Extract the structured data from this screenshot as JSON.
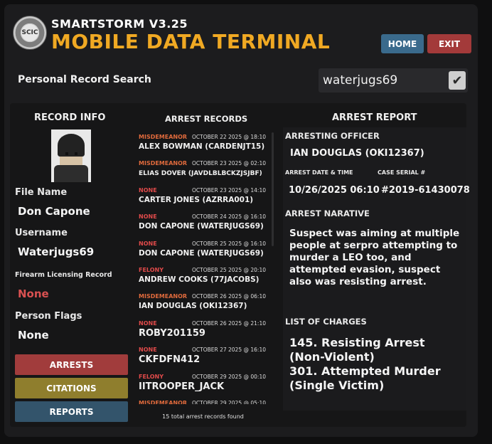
{
  "header": {
    "seal_text": "SCIC",
    "app_title": "SMARTSTORM V3.25",
    "app_subtitle": "MOBILE DATA TERMINAL",
    "home_label": "HOME",
    "exit_label": "EXIT"
  },
  "search": {
    "label": "Personal Record Search",
    "value": "waterjugs69",
    "check_glyph": "✔"
  },
  "record_info": {
    "heading": "RECORD INFO",
    "file_name_label": "File Name",
    "file_name_value": "Don Capone",
    "username_label": "Username",
    "username_value": "Waterjugs69",
    "firearm_label": "Firearm Licensing Record",
    "firearm_value": "None",
    "flags_label": "Person Flags",
    "flags_value": "None",
    "buttons": {
      "arrests": "ARRESTS",
      "citations": "CITATIONS",
      "reports": "REPORTS"
    }
  },
  "arrest_records": {
    "heading": "ARREST RECORDS",
    "items": [
      {
        "type": "MISDEMEANOR",
        "date": "OCTOBER 22 2025 @ 18:10",
        "name": "ALEX BOWMAN (CARDENJT15)"
      },
      {
        "type": "MISDEMEANOR",
        "date": "OCTOBER 23 2025 @ 02:10",
        "name": "ELIAS DOVER (JAVDLBLBCKZJSJBF)"
      },
      {
        "type": "NONE",
        "date": "OCTOBER 23 2025 @ 14:10",
        "name": "CARTER JONES (AZRRA001)"
      },
      {
        "type": "NONE",
        "date": "OCTOBER 24 2025 @ 16:10",
        "name": "DON CAPONE (WATERJUGS69)"
      },
      {
        "type": "NONE",
        "date": "OCTOBER 25 2025 @ 16:10",
        "name": "DON CAPONE (WATERJUGS69)"
      },
      {
        "type": "FELONY",
        "date": "OCTOBER 25 2025 @ 20:10",
        "name": "ANDREW COOKS (77JACOBS)"
      },
      {
        "type": "MISDEMEANOR",
        "date": "OCTOBER 26 2025 @ 06:10",
        "name": "IAN DOUGLAS (OKI12367)"
      },
      {
        "type": "NONE",
        "date": "OCTOBER 26 2025 @ 21:10",
        "name": "ROBY201159"
      },
      {
        "type": "NONE",
        "date": "OCTOBER 27 2025 @ 16:10",
        "name": "CKFDFN412"
      },
      {
        "type": "FELONY",
        "date": "OCTOBER 29 2025 @ 00:10",
        "name": "IITROOPER_JACK"
      },
      {
        "type": "MISDEMEANOR",
        "date": "OCTOBER 29 2025 @ 05:10",
        "name": ""
      }
    ],
    "footer": "15 total arrest records found"
  },
  "arrest_report": {
    "heading": "ARREST REPORT",
    "officer_label": "ARRESTING OFFICER",
    "officer_value": "IAN DOUGLAS (OKI12367)",
    "datetime_label": "ARREST DATE & TIME",
    "datetime_value": "10/26/2025 06:10",
    "serial_label": "CASE SERIAL #",
    "serial_value": "#2019-61430078",
    "narrative_label": "ARREST NARATIVE",
    "narrative": "Suspect was aiming at multiple people at serpro attempting to murder a LEO too, and attempted evasion, suspect also was resisting arrest.",
    "charges_label": "LIST OF CHARGES",
    "charges": [
      "145. Resisting Arrest (Non-Violent)",
      "301. Attempted Murder (Single Victim)"
    ]
  },
  "colors": {
    "accent_yellow": "#f0a923",
    "misdemeanor": "#e06a3c",
    "none": "#e04a4a",
    "felony": "#e04a4a",
    "home_button": "#3a6a8c",
    "exit_button": "#a33a3a"
  }
}
